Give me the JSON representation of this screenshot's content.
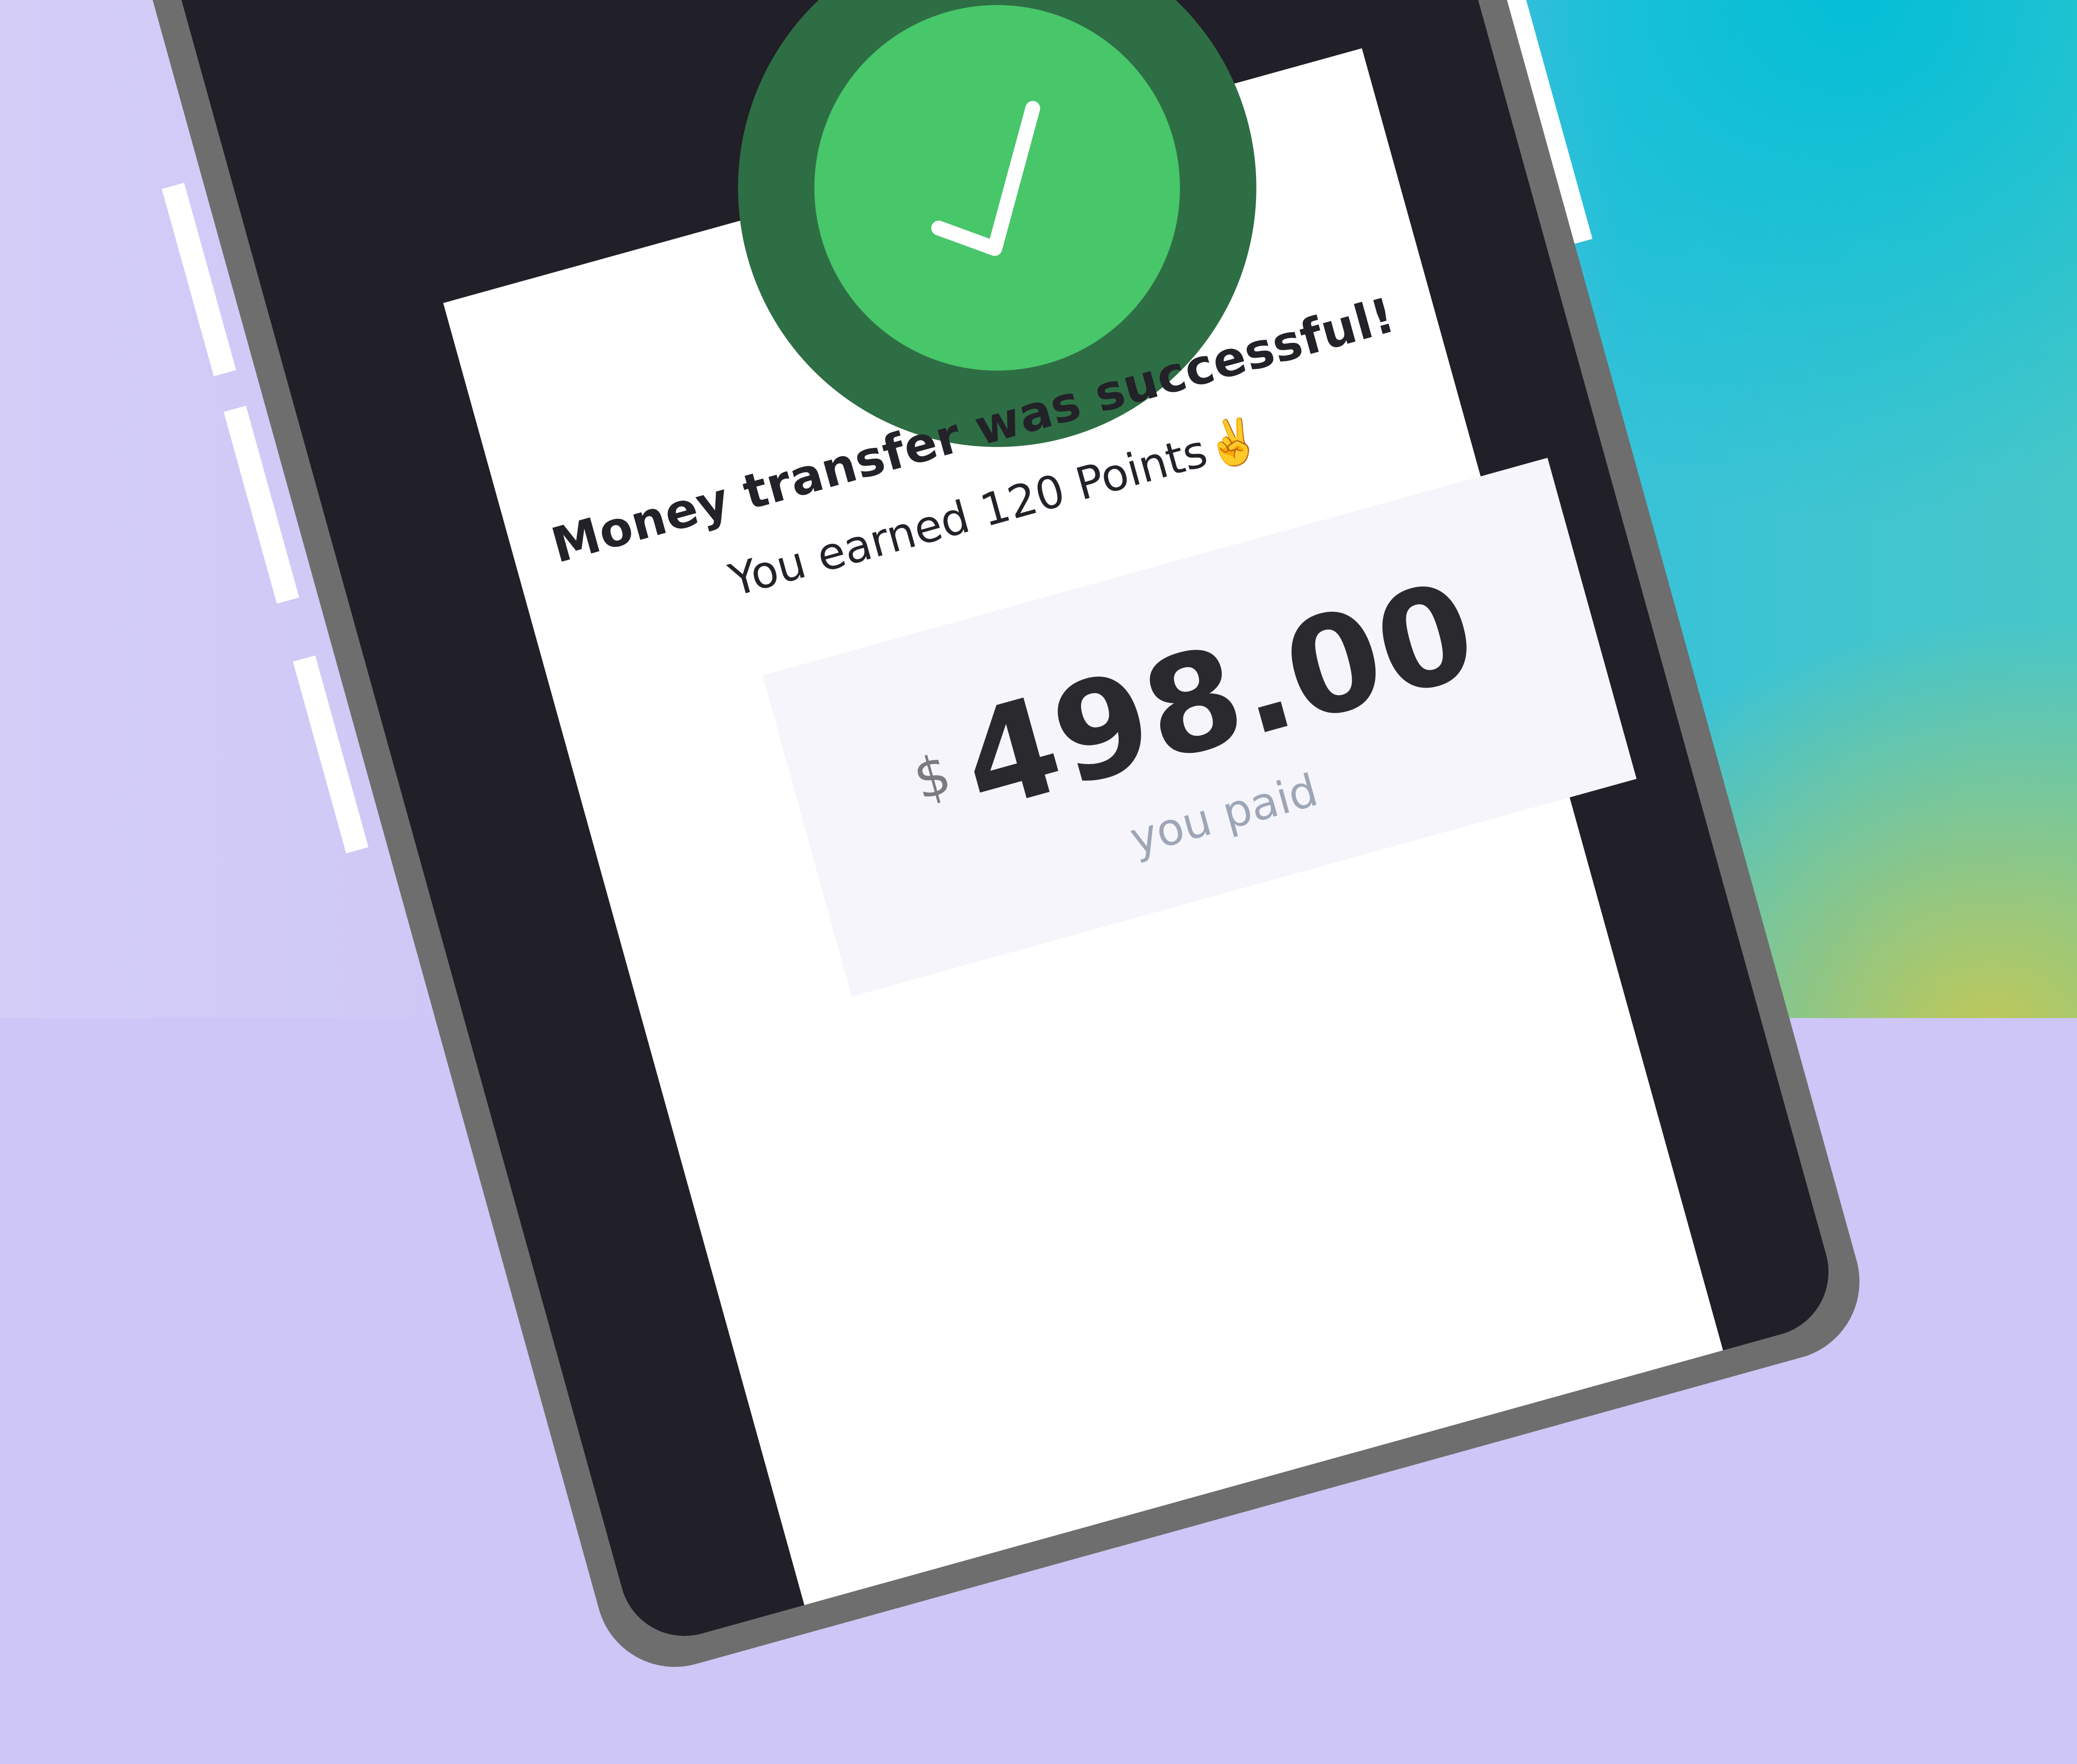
{
  "success_icon": "check-icon",
  "message": {
    "title": "Money transfer was successful!",
    "points_text": "You earned 120 Points✌️"
  },
  "payment": {
    "currency_symbol": "$",
    "amount": "498.00",
    "caption": "you paid"
  },
  "colors": {
    "success_green": "#48c66a",
    "success_ring": "#2e6e45",
    "phone_screen": "#211f28",
    "card_background": "#ffffff",
    "amount_box": "#f5f5fb"
  }
}
